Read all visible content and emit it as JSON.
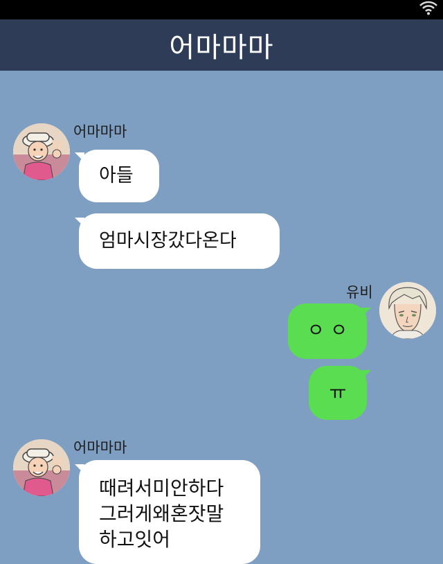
{
  "chat_title": "어마마마",
  "colors": {
    "header_bg": "#2e3c57",
    "chat_bg": "#7f9fc2",
    "incoming_bubble": "#ffffff",
    "outgoing_bubble": "#5bdd52"
  },
  "status_bar": {
    "icon": "wifi-icon"
  },
  "messages": [
    {
      "sender": "어마마마",
      "direction": "incoming",
      "text": "아들"
    },
    {
      "sender": "어마마마",
      "direction": "incoming",
      "text": "엄마시장갔다온다"
    },
    {
      "sender": "유비",
      "direction": "outgoing",
      "text": "ㅇㅇ"
    },
    {
      "sender": "유비",
      "direction": "outgoing",
      "text": "ㅠ"
    },
    {
      "sender": "어마마마",
      "direction": "incoming",
      "text": "때려서미안하다\n그러게왜혼잣말\n하고잇어"
    }
  ],
  "display": {
    "group1_sender": "어마마마",
    "group2_sender": "유비",
    "group3_sender": "어마마마",
    "m3_spaced": "ㅇ ㅇ",
    "m5_line1": "때려서미안하다",
    "m5_line2": "그러게왜혼잣말",
    "m5_line3": "하고잇어"
  }
}
